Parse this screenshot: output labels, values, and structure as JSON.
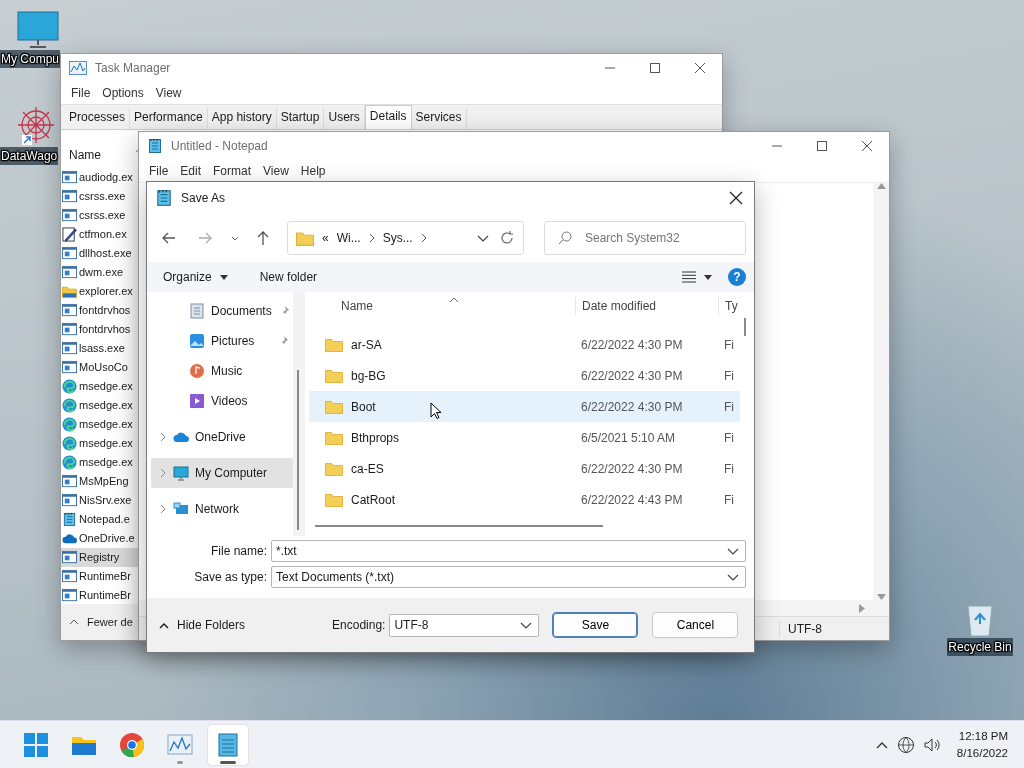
{
  "desktop_icons": [
    {
      "label": "My Compu",
      "kind": "computer"
    },
    {
      "label": "DataWago",
      "kind": "shortcut"
    },
    {
      "label": "Recycle Bin",
      "kind": "recycle"
    }
  ],
  "task_manager": {
    "title": "Task Manager",
    "menu": [
      "File",
      "Options",
      "View"
    ],
    "tabs": [
      {
        "label": "Processes",
        "selected": false
      },
      {
        "label": "Performance",
        "selected": false
      },
      {
        "label": "App history",
        "selected": false
      },
      {
        "label": "Startup",
        "selected": false
      },
      {
        "label": "Users",
        "selected": false
      },
      {
        "label": "Details",
        "selected": true
      },
      {
        "label": "Services",
        "selected": false
      }
    ],
    "column": "Name",
    "processes": [
      {
        "name": "audiodg.ex",
        "kind": "exe",
        "selected": false
      },
      {
        "name": "csrss.exe",
        "kind": "exe",
        "selected": false
      },
      {
        "name": "csrss.exe",
        "kind": "exe",
        "selected": false
      },
      {
        "name": "ctfmon.ex",
        "kind": "pen",
        "selected": false
      },
      {
        "name": "dllhost.exe",
        "kind": "exe",
        "selected": false
      },
      {
        "name": "dwm.exe",
        "kind": "exe",
        "selected": false
      },
      {
        "name": "explorer.ex",
        "kind": "folder",
        "selected": false
      },
      {
        "name": "fontdrvhos",
        "kind": "exe",
        "selected": false
      },
      {
        "name": "fontdrvhos",
        "kind": "exe",
        "selected": false
      },
      {
        "name": "lsass.exe",
        "kind": "exe",
        "selected": false
      },
      {
        "name": "MoUsoCo",
        "kind": "exe",
        "selected": false
      },
      {
        "name": "msedge.ex",
        "kind": "edge",
        "selected": false
      },
      {
        "name": "msedge.ex",
        "kind": "edge",
        "selected": false
      },
      {
        "name": "msedge.ex",
        "kind": "edge",
        "selected": false
      },
      {
        "name": "msedge.ex",
        "kind": "edge",
        "selected": false
      },
      {
        "name": "msedge.ex",
        "kind": "edge",
        "selected": false
      },
      {
        "name": "MsMpEng",
        "kind": "exe",
        "selected": false
      },
      {
        "name": "NisSrv.exe",
        "kind": "exe",
        "selected": false
      },
      {
        "name": "Notepad.e",
        "kind": "notepad",
        "selected": false
      },
      {
        "name": "OneDrive.e",
        "kind": "cloud",
        "selected": false
      },
      {
        "name": "Registry",
        "kind": "exe",
        "selected": true
      },
      {
        "name": "RuntimeBr",
        "kind": "exe",
        "selected": false
      },
      {
        "name": "RuntimeBr",
        "kind": "exe",
        "selected": false
      }
    ],
    "footer": "Fewer de"
  },
  "notepad": {
    "title": "Untitled - Notepad",
    "menu": [
      "File",
      "Edit",
      "Format",
      "View",
      "Help"
    ],
    "status_encoding": "UTF-8"
  },
  "save_dialog": {
    "title": "Save As",
    "breadcrumb": {
      "overflow": "«",
      "parts": [
        "Wi...",
        "Sys..."
      ]
    },
    "search": {
      "placeholder": "Search System32"
    },
    "toolbar": {
      "organize": "Organize",
      "new_folder": "New folder",
      "help": "?"
    },
    "nav_items": [
      {
        "label": "Documents",
        "kind": "documents",
        "pinned": true,
        "expandable": false,
        "selected": false
      },
      {
        "label": "Pictures",
        "kind": "pictures",
        "pinned": true,
        "expandable": false,
        "selected": false
      },
      {
        "label": "Music",
        "kind": "music",
        "pinned": false,
        "expandable": false,
        "selected": false
      },
      {
        "label": "Videos",
        "kind": "videos",
        "pinned": false,
        "expandable": false,
        "selected": false
      },
      {
        "label": "OneDrive",
        "kind": "onedrive",
        "pinned": false,
        "expandable": true,
        "selected": false
      },
      {
        "label": "My Computer",
        "kind": "computer",
        "pinned": false,
        "expandable": true,
        "selected": true
      },
      {
        "label": "Network",
        "kind": "network",
        "pinned": false,
        "expandable": true,
        "selected": false
      }
    ],
    "columns": [
      "Name",
      "Date modified",
      "Ty"
    ],
    "files": [
      {
        "name": "ar-SA",
        "date": "6/22/2022 4:30 PM",
        "type": "Fi",
        "highlighted": false
      },
      {
        "name": "bg-BG",
        "date": "6/22/2022 4:30 PM",
        "type": "Fi",
        "highlighted": false
      },
      {
        "name": "Boot",
        "date": "6/22/2022 4:30 PM",
        "type": "Fi",
        "highlighted": true
      },
      {
        "name": "Bthprops",
        "date": "6/5/2021 5:10 AM",
        "type": "Fi",
        "highlighted": false
      },
      {
        "name": "ca-ES",
        "date": "6/22/2022 4:30 PM",
        "type": "Fi",
        "highlighted": false
      },
      {
        "name": "CatRoot",
        "date": "6/22/2022 4:43 PM",
        "type": "Fi",
        "highlighted": false
      }
    ],
    "file_name": {
      "label": "File name:",
      "value": "*.txt"
    },
    "save_type": {
      "label": "Save as type:",
      "value": "Text Documents (*.txt)"
    },
    "hide_folders": "Hide Folders",
    "encoding": {
      "label": "Encoding:",
      "value": "UTF-8"
    },
    "buttons": [
      "Save",
      "Cancel"
    ]
  },
  "taskbar": {
    "apps": [
      {
        "kind": "start",
        "running": false,
        "active": false
      },
      {
        "kind": "explorer",
        "running": false,
        "active": false
      },
      {
        "kind": "chrome",
        "running": false,
        "active": false
      },
      {
        "kind": "taskmgr",
        "running": true,
        "active": false
      },
      {
        "kind": "notepad",
        "running": true,
        "active": true
      }
    ],
    "clock": {
      "time": "12:18 PM",
      "date": "8/16/2022"
    }
  }
}
